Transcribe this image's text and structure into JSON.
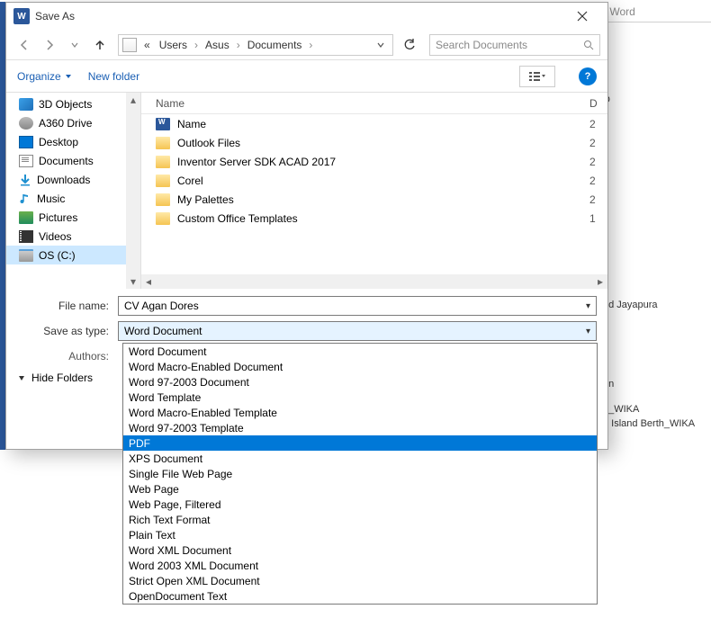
{
  "background": {
    "title_frag": "- Word",
    "snippets": {
      "d_header": "D",
      "d1": "2",
      "d2": "2",
      "d3": "2",
      "d4": "2",
      "d5": "2",
      "d6": "1",
      "s1": "ed Jayapura",
      "s2": "g",
      "s3": "en",
      "s4": "h_WIKA",
      "s5": "n Island Berth_WIKA"
    }
  },
  "titlebar": {
    "title": "Save As",
    "word_glyph": "W"
  },
  "nav": {
    "crumb_prefix": "«",
    "crumbs": [
      "Users",
      "Asus",
      "Documents"
    ],
    "sep": "›",
    "search_placeholder": "Search Documents"
  },
  "toolbar": {
    "organize": "Organize",
    "newfolder": "New folder",
    "help": "?"
  },
  "tree": {
    "items": [
      {
        "label": "3D Objects",
        "icon": "obj3d"
      },
      {
        "label": "A360 Drive",
        "icon": "a360"
      },
      {
        "label": "Desktop",
        "icon": "desktop"
      },
      {
        "label": "Documents",
        "icon": "docs"
      },
      {
        "label": "Downloads",
        "icon": "dl"
      },
      {
        "label": "Music",
        "icon": "music"
      },
      {
        "label": "Pictures",
        "icon": "pics"
      },
      {
        "label": "Videos",
        "icon": "vids"
      },
      {
        "label": "OS (C:)",
        "icon": "drive",
        "selected": true
      }
    ]
  },
  "filelist": {
    "col_name": "Name",
    "col_d": "D",
    "rows": [
      {
        "name": "Name",
        "icon": "word",
        "d": "2"
      },
      {
        "name": "Outlook Files",
        "icon": "folder",
        "d": "2"
      },
      {
        "name": "Inventor Server SDK ACAD 2017",
        "icon": "folder",
        "d": "2"
      },
      {
        "name": "Corel",
        "icon": "folder",
        "d": "2"
      },
      {
        "name": "My Palettes",
        "icon": "folder",
        "d": "2"
      },
      {
        "name": "Custom Office Templates",
        "icon": "folder",
        "d": "1"
      }
    ]
  },
  "fields": {
    "filename_label": "File name:",
    "filename_value": "CV Agan Dores",
    "saveastype_label": "Save as type:",
    "saveastype_value": "Word Document",
    "authors_label": "Authors:"
  },
  "hidefolders": "Hide Folders",
  "dropdown": {
    "selected_index": 6,
    "options": [
      "Word Document",
      "Word Macro-Enabled Document",
      "Word 97-2003 Document",
      "Word Template",
      "Word Macro-Enabled Template",
      "Word 97-2003 Template",
      "PDF",
      "XPS Document",
      "Single File Web Page",
      "Web Page",
      "Web Page, Filtered",
      "Rich Text Format",
      "Plain Text",
      "Word XML Document",
      "Word 2003 XML Document",
      "Strict Open XML Document",
      "OpenDocument Text"
    ]
  }
}
